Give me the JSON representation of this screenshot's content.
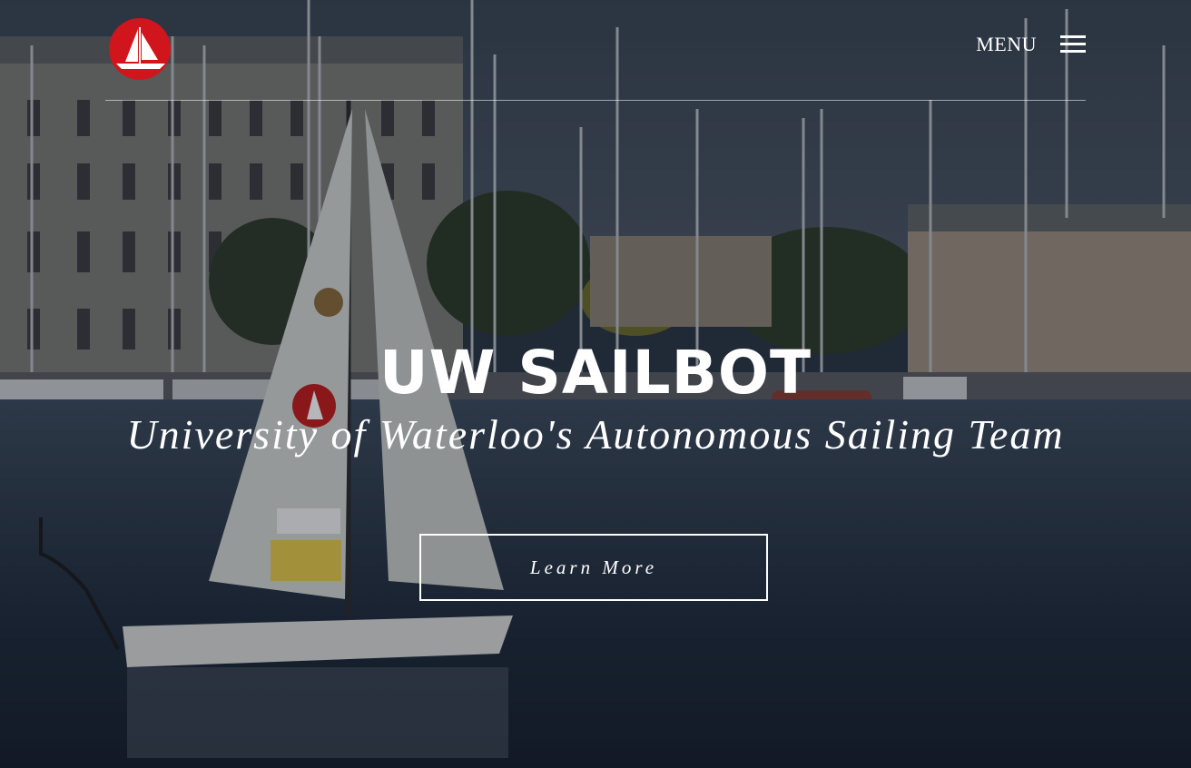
{
  "brand": {
    "logo_icon": "sailboat-logo-icon",
    "logo_color": "#d0161c"
  },
  "nav": {
    "menu_label": "MENU",
    "menu_icon": "hamburger-icon"
  },
  "hero": {
    "title": "UW SAILBOT",
    "subtitle": "University of Waterloo's Autonomous Sailing Team",
    "cta_label": "Learn More"
  },
  "colors": {
    "text": "#ffffff",
    "overlay": "#1a2230"
  }
}
